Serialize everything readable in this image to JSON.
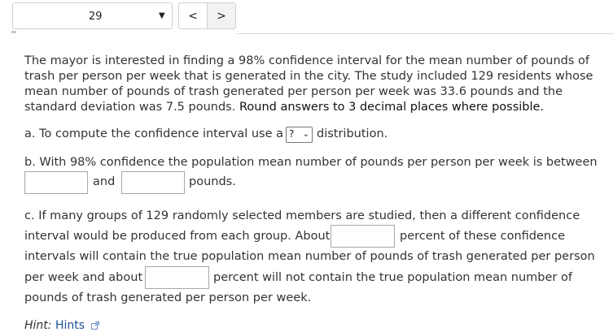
{
  "nav": {
    "question_number": "29",
    "prev_label": "<",
    "next_label": ">"
  },
  "problem": {
    "text": "The mayor is interested in finding a 98% confidence interval for the mean number of pounds of trash per person per week that is generated in the city. The study included 129 residents whose mean number of pounds of trash generated per person per week was 33.6 pounds and the standard deviation was 7.5 pounds.",
    "instruction": "Round answers to 3 decimal places where possible."
  },
  "part_a": {
    "text_before": "a. To compute the confidence interval use a",
    "select_value": "?",
    "text_after": "distribution."
  },
  "part_b": {
    "text": "b. With 98% confidence the population mean number of pounds per person per week is between",
    "and_label": "and",
    "units_label": "pounds."
  },
  "part_c": {
    "line1": "c. If many groups of 129 randomly selected members are studied, then a different confidence",
    "line2_before": "interval would be produced from each group. About",
    "line2_after": "percent of these confidence",
    "line3": "intervals will contain the true population mean number of pounds of trash generated per person",
    "line4_before": "per week and about",
    "line4_after": "percent will not contain the true population mean number of",
    "line5": "pounds of trash generated per person per week."
  },
  "hint": {
    "label": "Hint:",
    "link_text": "Hints"
  }
}
